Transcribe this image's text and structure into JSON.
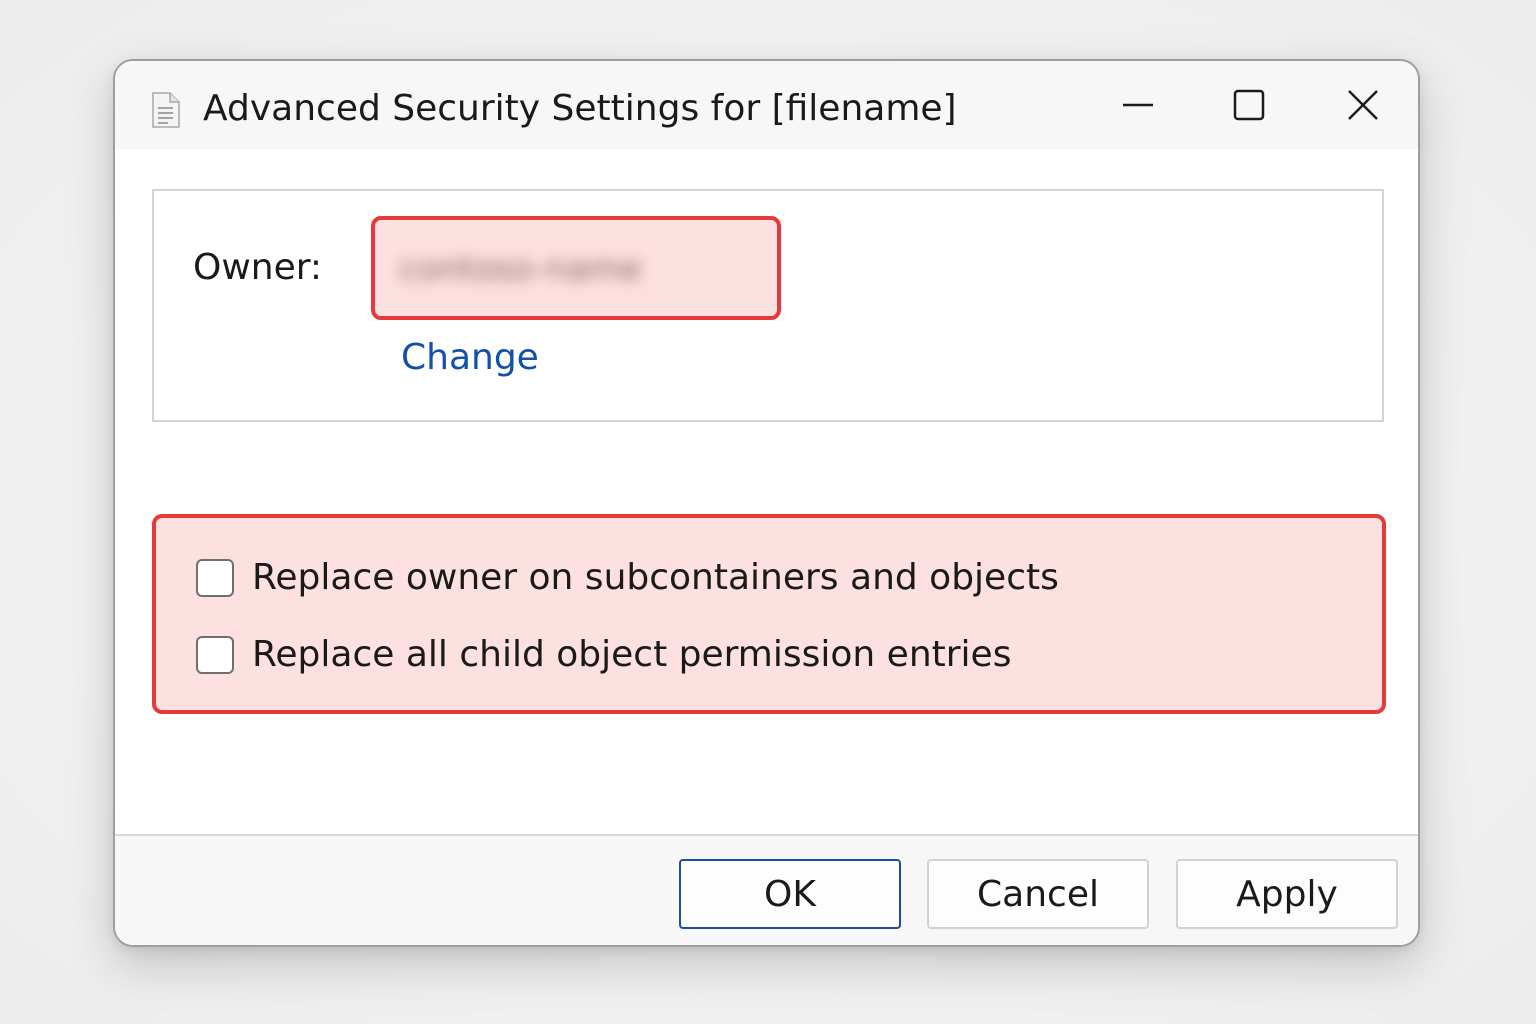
{
  "window": {
    "title": "Advanced Security Settings for [filename]",
    "title_icon": "document-icon",
    "controls": {
      "minimize": "minimize-icon",
      "maximize": "maximize-icon",
      "close": "close-icon"
    }
  },
  "owner": {
    "label": "Owner:",
    "value": "contoso-name",
    "value_obscured": true,
    "change_link": "Change",
    "highlight_color": "#e63a3a",
    "highlight_fill": "#fde0e0"
  },
  "options": [
    {
      "label": "Replace owner on subcontainers and objects",
      "checked": false
    },
    {
      "label": "Replace all child object permission entries",
      "checked": false
    }
  ],
  "buttons": {
    "ok": "OK",
    "cancel": "Cancel",
    "apply": "Apply"
  },
  "colors": {
    "link": "#1450a8",
    "default_button_border": "#1a4fa0",
    "highlight_border": "#e63a3a"
  }
}
